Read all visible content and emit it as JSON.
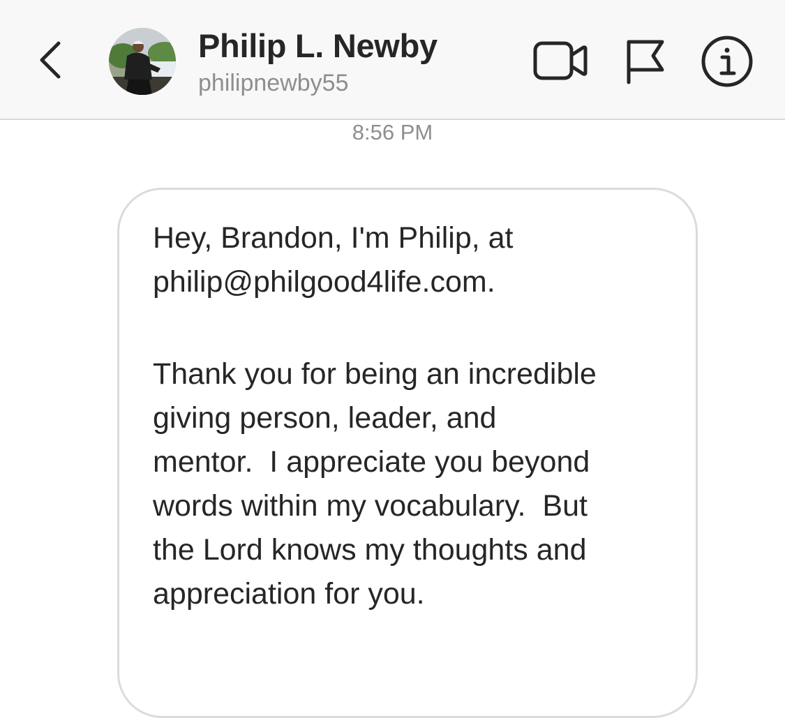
{
  "header": {
    "name": "Philip L. Newby",
    "username": "philipnewby55",
    "icons": {
      "back": "chevron-left-icon",
      "video": "video-camera-icon",
      "flag": "flag-icon",
      "info": "info-icon"
    }
  },
  "thread": {
    "timestamp": "8:56 PM",
    "message": {
      "paragraph1": "Hey, Brandon, I'm Philip, at\nphilip@philgood4life.com.",
      "paragraph2": "Thank you for being an incredible\ngiving person, leader, and\nmentor.  I appreciate you beyond\nwords within my vocabulary.  But\nthe Lord knows my thoughts and\nappreciation for you."
    }
  },
  "colors": {
    "header_bg": "#f8f8f8",
    "text": "#262626",
    "secondary_text": "#8e8e8e",
    "bubble_border": "#dbdbdb"
  }
}
